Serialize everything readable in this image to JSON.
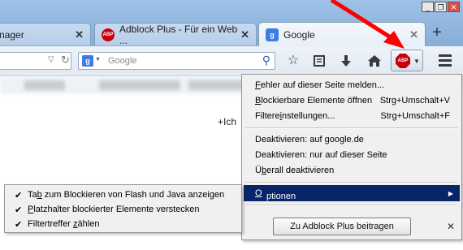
{
  "window": {
    "min_label": "_",
    "max_label": "❐",
    "close_label": "✕"
  },
  "tabs": [
    {
      "title": "nager",
      "close": "✕"
    },
    {
      "title": "Adblock Plus - Für ein Web ...",
      "close": "✕",
      "favicon": "ABP"
    },
    {
      "title": "Google",
      "close": "✕",
      "favicon": "g"
    }
  ],
  "newtab_label": "+",
  "navbar": {
    "search_placeholder": "Google",
    "search_engine_icon": "g"
  },
  "toolbar_icons": [
    "star-icon",
    "reading-list-icon",
    "download-icon",
    "home-icon"
  ],
  "abp_button_label": "ABP",
  "page": {
    "content_text": "+Ich"
  },
  "menu": {
    "report": {
      "pre": "",
      "u": "F",
      "post": "ehler auf dieser Seite melden..."
    },
    "blockable": {
      "pre": "",
      "u": "B",
      "post": "lockierbare Elemente öffnen",
      "accel": "Strg+Umschalt+V"
    },
    "filter_settings": {
      "pre": "Filtere",
      "u": "i",
      "post": "nstellungen...",
      "accel": "Strg+Umschalt+F"
    },
    "disable_site": "Deaktivieren: auf google.de",
    "disable_page": "Deaktivieren: nur auf dieser Seite",
    "disable_all": {
      "pre": "Ü",
      "u": "b",
      "post": "erall deaktivieren"
    },
    "options": {
      "pre": "",
      "u": "O",
      "post": "ptionen",
      "arrow": "▶"
    },
    "contribute_button": "Zu Adblock Plus beitragen",
    "close_label": "✕"
  },
  "submenu": {
    "items": [
      {
        "check": "✔",
        "pre": "Ta",
        "u": "b",
        "post": " zum Blockieren von Flash und Java anzeigen"
      },
      {
        "check": "✔",
        "pre": "",
        "u": "P",
        "post": "latzhalter blockierter Elemente verstecken"
      },
      {
        "check": "✔",
        "pre": "Filtertreffer ",
        "u": "z",
        "post": "ählen"
      }
    ]
  },
  "colors": {
    "highlight": "#0a246a",
    "abp_red": "#c7000b",
    "annotation_arrow": "#ff0000"
  }
}
